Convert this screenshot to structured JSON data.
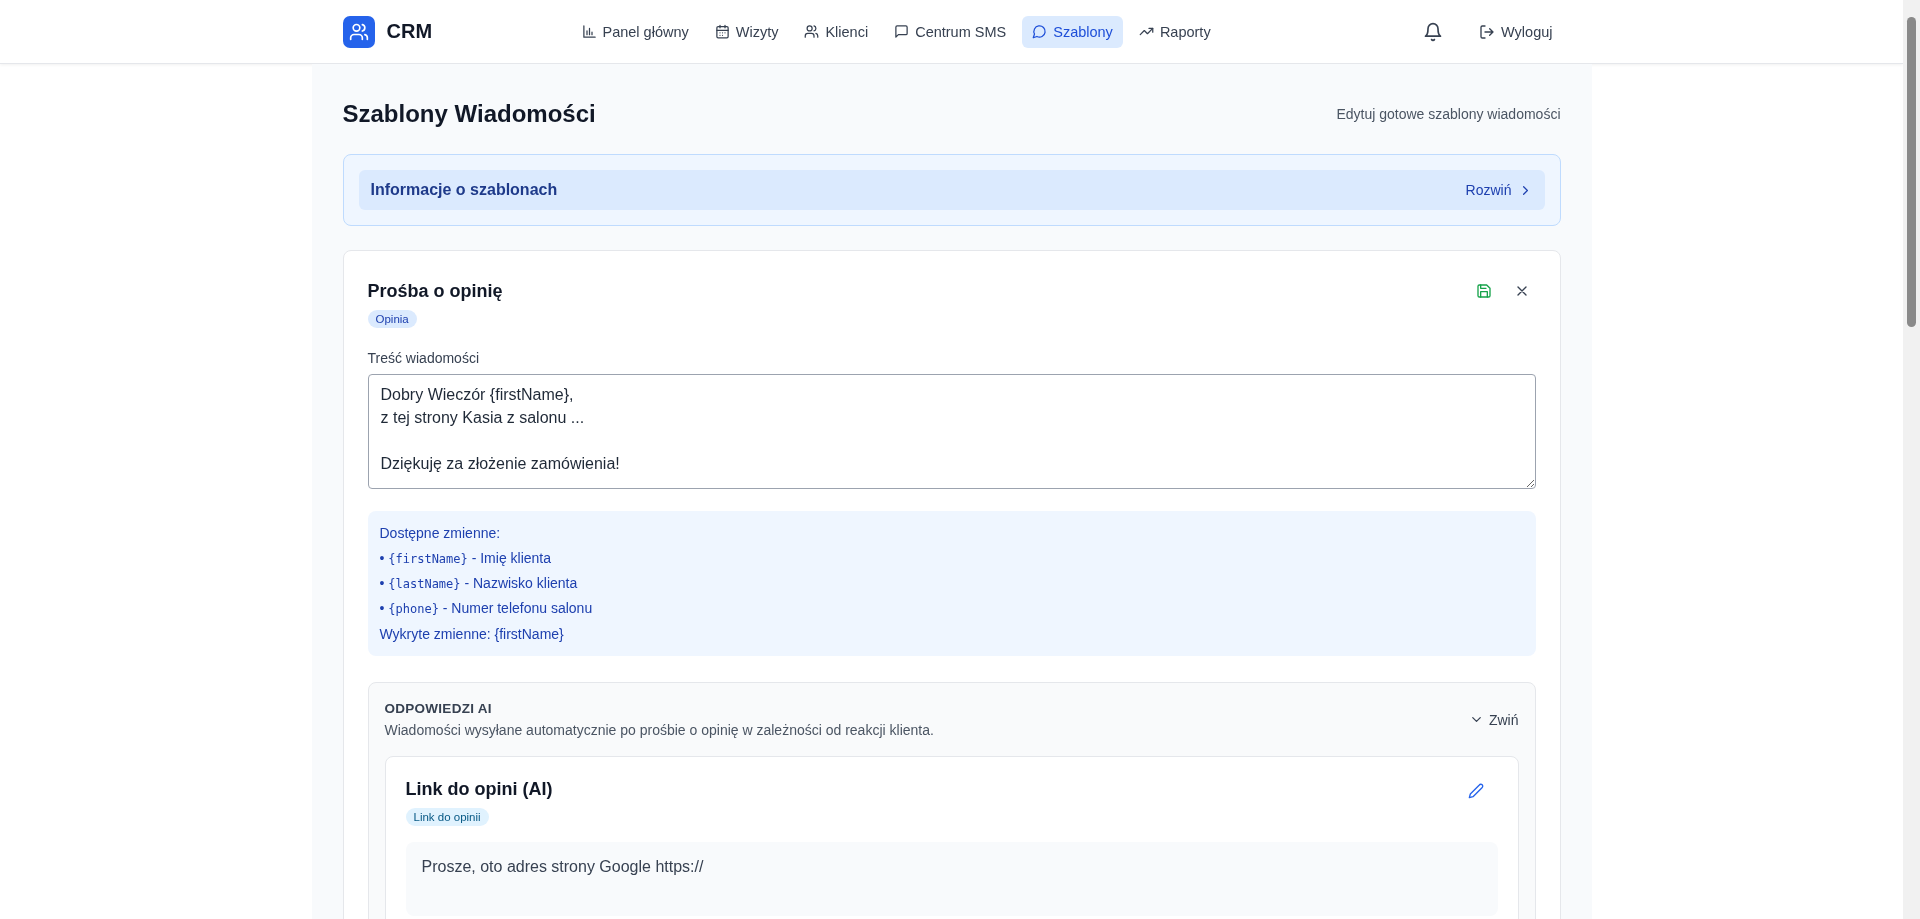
{
  "brand": {
    "name": "CRM"
  },
  "nav": [
    {
      "label": "Panel główny",
      "selected": false
    },
    {
      "label": "Wizyty",
      "selected": false
    },
    {
      "label": "Klienci",
      "selected": false
    },
    {
      "label": "Centrum SMS",
      "selected": false
    },
    {
      "label": "Szablony",
      "selected": true
    },
    {
      "label": "Raporty",
      "selected": false
    }
  ],
  "logout": {
    "label": "Wyloguj"
  },
  "page": {
    "title": "Szablony Wiadomości",
    "subtitle": "Edytuj gotowe szablony wiadomości"
  },
  "info_panel": {
    "title": "Informacje o szablonach",
    "toggle": "Rozwiń",
    "expanded": false
  },
  "template": {
    "title": "Prośba o opinię",
    "tag": "Opinia",
    "field_label": "Treść wiadomości",
    "message": "Dobry Wieczór {firstName},\nz tej strony Kasia z salonu ...\n\nDziękuję za złożenie zamówienia!",
    "variables_title": "Dostępne zmienne:",
    "variables": [
      {
        "bullet": "•",
        "code": "{firstName}",
        "desc": "- Imię klienta"
      },
      {
        "bullet": "•",
        "code": "{lastName}",
        "desc": "- Nazwisko klienta"
      },
      {
        "bullet": "•",
        "code": "{phone}",
        "desc": "- Numer telefonu salonu"
      }
    ],
    "detected": "Wykryte zmienne: {firstName}"
  },
  "ai_section": {
    "title": "ODPOWIEDZI AI",
    "description": "Wiadomości wysyłane automatycznie po prośbie o opinię w zależności od reakcji klienta.",
    "toggle": "Zwiń",
    "expanded": true,
    "cards": [
      {
        "title": "Link do opini (AI)",
        "tag": "Link do opinii",
        "message": "Prosze, oto adres strony Google https://"
      }
    ]
  }
}
